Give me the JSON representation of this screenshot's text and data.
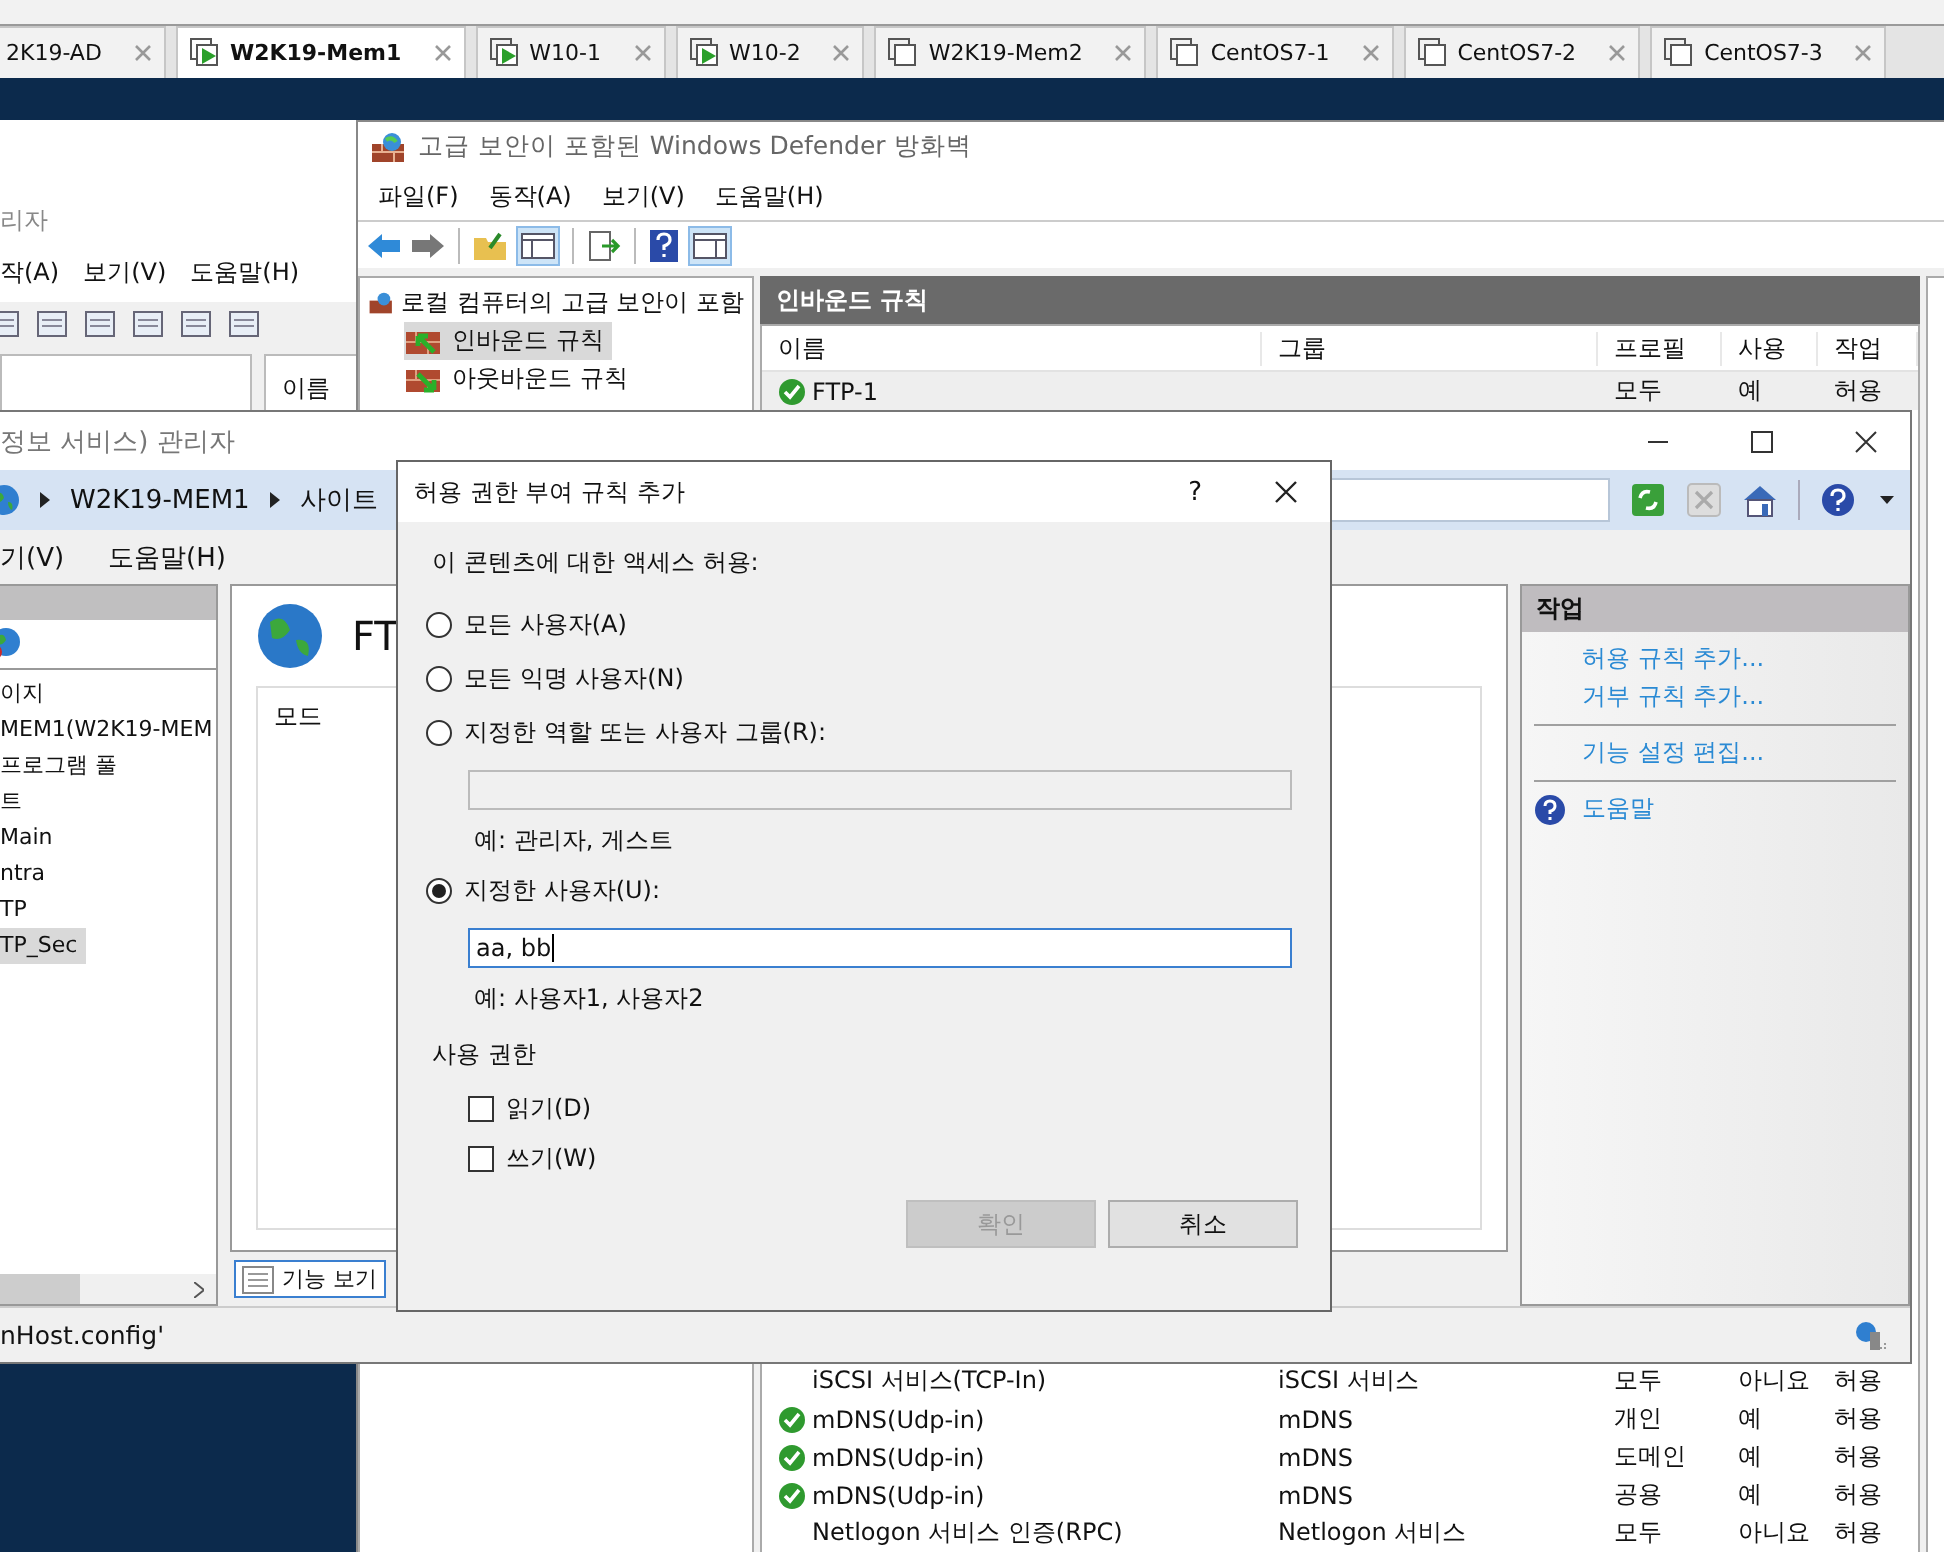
{
  "vm_tabs": [
    {
      "label": "2K19-AD",
      "selected": false
    },
    {
      "label": "W2K19-Mem1",
      "running": true,
      "selected": true
    },
    {
      "label": "W10-1",
      "running": true,
      "selected": false
    },
    {
      "label": "W10-2",
      "running": true,
      "selected": false
    },
    {
      "label": "W2K19-Mem2",
      "running": false,
      "selected": false
    },
    {
      "label": "CentOS7-1",
      "running": false,
      "selected": false
    },
    {
      "label": "CentOS7-2",
      "running": false,
      "selected": false
    },
    {
      "label": "CentOS7-3",
      "running": false,
      "selected": false
    }
  ],
  "back_window": {
    "title": "리자",
    "menu": [
      "작(A)",
      "보기(V)",
      "도움말(H)"
    ],
    "column": "이름"
  },
  "firewall": {
    "title": "고급 보안이 포함된 Windows Defender 방화벽",
    "menu": [
      "파일(F)",
      "동작(A)",
      "보기(V)",
      "도움말(H)"
    ],
    "tree": [
      {
        "label": "로컬 컴퓨터의 고급 보안이 포함",
        "children": [
          {
            "label": "인바운드 규칙",
            "kind": "inbound",
            "selected": true
          },
          {
            "label": "아웃바운드 규칙",
            "kind": "outbound",
            "selected": false
          }
        ]
      }
    ],
    "panel_title": "인바운드 규칙",
    "columns": [
      "이름",
      "그룹",
      "프로필",
      "사용",
      "작업"
    ],
    "rows_top": [
      {
        "name": "FTP-1",
        "profile": "모두",
        "in_use": "예",
        "action": "허용",
        "enabled": true
      }
    ],
    "rows_bottom": [
      {
        "name": "iSCSI 서비스(TCP-In)",
        "group": "iSCSI 서비스",
        "profile": "모두",
        "in_use": "아니요",
        "action": "허용",
        "enabled": false
      },
      {
        "name": "mDNS(Udp-in)",
        "group": "mDNS",
        "profile": "개인",
        "in_use": "예",
        "action": "허용",
        "enabled": true
      },
      {
        "name": "mDNS(Udp-in)",
        "group": "mDNS",
        "profile": "도메인",
        "in_use": "예",
        "action": "허용",
        "enabled": true
      },
      {
        "name": "mDNS(Udp-in)",
        "group": "mDNS",
        "profile": "공용",
        "in_use": "예",
        "action": "허용",
        "enabled": true
      },
      {
        "name": "Netlogon 서비스 인증(RPC)",
        "group": "Netlogon 서비스",
        "profile": "모두",
        "in_use": "아니요",
        "action": "허용",
        "enabled": false
      }
    ]
  },
  "iis": {
    "title": "정보 서비스) 관리자",
    "breadcrumb": [
      "W2K19-MEM1",
      "사이트"
    ],
    "menu": [
      "기(V)",
      "도움말(H)"
    ],
    "tree": [
      {
        "label": "이지",
        "selected": false
      },
      {
        "label": "MEM1(W2K19-MEM",
        "selected": false
      },
      {
        "label": "프로그램 풀",
        "selected": false
      },
      {
        "label": "트",
        "selected": false
      },
      {
        "label": "Main",
        "selected": false
      },
      {
        "label": "ntra",
        "selected": false
      },
      {
        "label": "TP",
        "selected": false
      },
      {
        "label": "TP_Sec",
        "selected": true
      }
    ],
    "feature_title": "FT",
    "column": "모드",
    "view_tab": "기능 보기",
    "actions_title": "작업",
    "action_groups": [
      [
        {
          "label": "허용 규칙 추가...",
          "kind": "link"
        },
        {
          "label": "거부 규칙 추가...",
          "kind": "link"
        }
      ],
      [
        {
          "label": "기능 설정 편집...",
          "kind": "link"
        }
      ],
      [
        {
          "label": "도움말",
          "kind": "help"
        }
      ]
    ],
    "status": "nHost.config'"
  },
  "dialog": {
    "title": "허용 권한 부여 규칙 추가",
    "help": "?",
    "prompt": "이 콘텐츠에 대한 액세스 허용:",
    "options": [
      {
        "label": "모든 사용자(A)",
        "kind": "plain",
        "selected": false
      },
      {
        "label": "모든 익명 사용자(N)",
        "kind": "plain",
        "selected": false
      },
      {
        "label": "지정한 역할 또는 사용자 그룹(R):",
        "kind": "field",
        "selected": false,
        "hint": "예: 관리자, 게스트"
      },
      {
        "label": "지정한 사용자(U):",
        "kind": "field",
        "selected": true,
        "value": "aa, bb",
        "hint": "예: 사용자1, 사용자2"
      }
    ],
    "permissions_title": "사용 권한",
    "permissions": [
      {
        "label": "읽기(D)",
        "checked": false
      },
      {
        "label": "쓰기(W)",
        "checked": false
      }
    ],
    "buttons": [
      {
        "label": "확인",
        "disabled": true
      },
      {
        "label": "취소",
        "disabled": false
      }
    ]
  }
}
